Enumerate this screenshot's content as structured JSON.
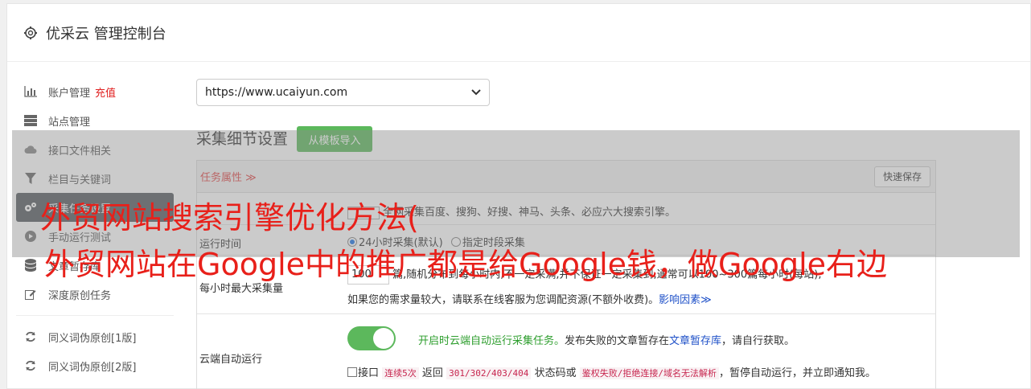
{
  "header": {
    "title": "优采云 管理控制台",
    "icon": "gear-icon"
  },
  "sidebar": {
    "items": [
      {
        "label": "账户管理",
        "extra": "充值",
        "icon": "bar-chart-icon"
      },
      {
        "label": "站点管理",
        "icon": "server-icon"
      },
      {
        "label": "接口文件相关",
        "icon": "cloud-upload-icon"
      },
      {
        "label": "栏目与关键词",
        "icon": "filter-icon"
      },
      {
        "label": "采集任务设置",
        "icon": "gears-icon",
        "active": true
      },
      {
        "label": "手动运行测试",
        "icon": "play-circle-icon"
      },
      {
        "label": "文章暂存库",
        "icon": "database-icon"
      },
      {
        "label": "深度原创任务",
        "icon": "edit-icon"
      },
      {
        "label": "同义词伪原创[1版]",
        "icon": "refresh-icon"
      },
      {
        "label": "同义词伪原创[2版]",
        "icon": "refresh-icon"
      }
    ]
  },
  "site_select": {
    "value": "https://www.ucaiyun.com"
  },
  "section": {
    "title": "采集细节设置",
    "import_button": "从模板导入"
  },
  "panel": {
    "task_attr": "任务属性 ≫",
    "quick_save": "快速保存",
    "engines_text": "全网采集百度、搜狗、好搜、神马、头条、必应六大搜索引擎。",
    "run_time_label": "运行时间",
    "run_time_opt1": "24小时采集(默认)",
    "run_time_opt2": "指定时段采集",
    "max_label": "每小时最大采集量",
    "max_value": "100",
    "max_note": "篇,随机分布到每小时内,不一定采满,并不保证一定采集到,通常可以100~300篇每小时(每站),",
    "max_help": "如果您的需求量较大，请联系在线客服为您调配资源(不额外收费)。",
    "max_help_link": "影响因素≫",
    "cloud_label": "云端自动运行",
    "cloud_on_text": "开启时云端自动运行采集任务。",
    "cloud_text2": "发布失败的文章暂存在",
    "cloud_link": "文章暂存库",
    "cloud_text3": "，请自行获取。",
    "cb_text1": "接口",
    "cb_code1": "连续5次",
    "cb_text2": "返回",
    "cb_code2": "301/302/403/404",
    "cb_text3": "状态码或",
    "cb_code3": "鉴权失败/拒绝连接/域名无法解析",
    "cb_text4": "，暂停自动运行，并立即通知我。"
  },
  "overlay": {
    "line1": "外贸网站搜索引擎优化方法(",
    "line2": "外贸网站在Google中的推广都是给Google钱，做Google右边"
  },
  "colors": {
    "accent_green": "#5cb85c",
    "overlay_red": "#e8201a",
    "active_bg": "#555a60"
  }
}
